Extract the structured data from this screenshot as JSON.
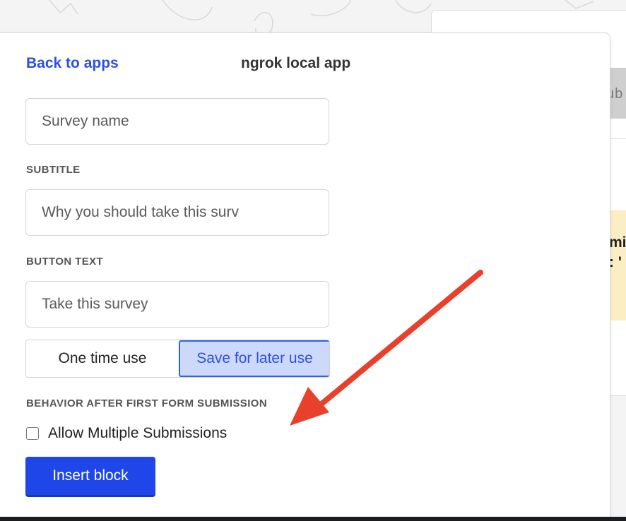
{
  "header": {
    "back_label": "Back to apps",
    "app_title": "ngrok local app"
  },
  "form": {
    "name_placeholder": "Survey name",
    "subtitle_label": "SUBTITLE",
    "subtitle_placeholder": "Why you should take this surv",
    "button_text_label": "BUTTON TEXT",
    "button_text_placeholder": "Take this survey",
    "usage_options": [
      "One time use",
      "Save for later use"
    ],
    "usage_selected": "Save for later use",
    "behavior_label": "BEHAVIOR AFTER FIRST FORM SUBMISSION",
    "allow_multiple_label": "Allow Multiple Submissions",
    "allow_multiple_checked": false,
    "insert_label": "Insert block"
  },
  "background": {
    "partial_text_1": "ub",
    "partial_text_2": "mi",
    "partial_text_3": ": '"
  },
  "colors": {
    "accent": "#1f46e8",
    "link": "#2b50e4",
    "selected_fill": "#cdd9fb",
    "annotation_arrow": "#e8402a",
    "warning_bg": "#fbedc4"
  }
}
